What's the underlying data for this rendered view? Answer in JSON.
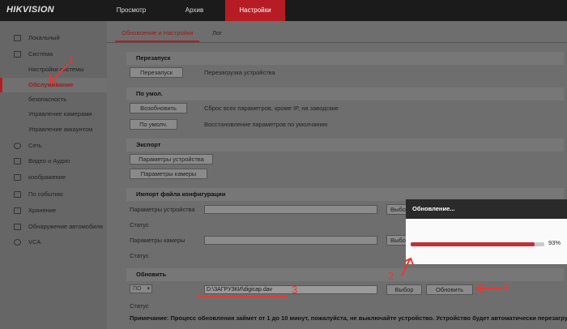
{
  "app": {
    "logo": "HIKVISION"
  },
  "nav": [
    {
      "label": "Просмотр"
    },
    {
      "label": "Архив"
    },
    {
      "label": "Настройки"
    }
  ],
  "sidebar": {
    "items": [
      {
        "label": "Локальный"
      },
      {
        "label": "Система"
      },
      {
        "label": "Настройки системы"
      },
      {
        "label": "Обслуживание"
      },
      {
        "label": "безопасность"
      },
      {
        "label": "Управление камерами"
      },
      {
        "label": "Управление аккаунтом"
      },
      {
        "label": "Сеть"
      },
      {
        "label": "Видео и Аудио"
      },
      {
        "label": "изображение"
      },
      {
        "label": "По событию"
      },
      {
        "label": "Хранение"
      },
      {
        "label": "Обнаружение автомобиля"
      },
      {
        "label": "VCA"
      }
    ]
  },
  "tabs": [
    {
      "label": "Обновление и Настройки"
    },
    {
      "label": "Лог"
    }
  ],
  "restart": {
    "title": "Перезапуск",
    "button": "Перезапуск",
    "desc": "Перезагрузка устройства"
  },
  "defaults": {
    "title": "По умол.",
    "restore_button": "Возобновить",
    "restore_desc": "Сброс всех параметров, кроме IP, на заводские",
    "default_button": "По умолч.",
    "default_desc": "Восстановление параметров по умолчанию"
  },
  "export": {
    "title": "Экспорт",
    "device_button": "Параметры устройства",
    "camera_button": "Параметры камеры"
  },
  "import": {
    "title": "Импорт файла конфигурации",
    "device_label": "Параметры устройства",
    "camera_label": "Параметры камеры",
    "status_label": "Статус",
    "browse_label": "Выбор"
  },
  "upgrade": {
    "title": "Обновить",
    "type_value": "ПО",
    "file_path": "D:\\ЗАГРУЗКИ\\digicap.dav",
    "browse_button": "Выбор",
    "upgrade_button": "Обновить",
    "status_label": "Статус",
    "note": "Примечание: Процесс обновления займет от 1 до 10 минут, пожалуйста, не выключайте устройство. Устройство будет автоматически перезагружено"
  },
  "dialog": {
    "title": "Обновление...",
    "progress": 0.93,
    "percent_label": "93%"
  },
  "annotations": {
    "n1": "1",
    "n2": "2",
    "n3": "3",
    "n4": "4",
    "color": "#e53935"
  }
}
